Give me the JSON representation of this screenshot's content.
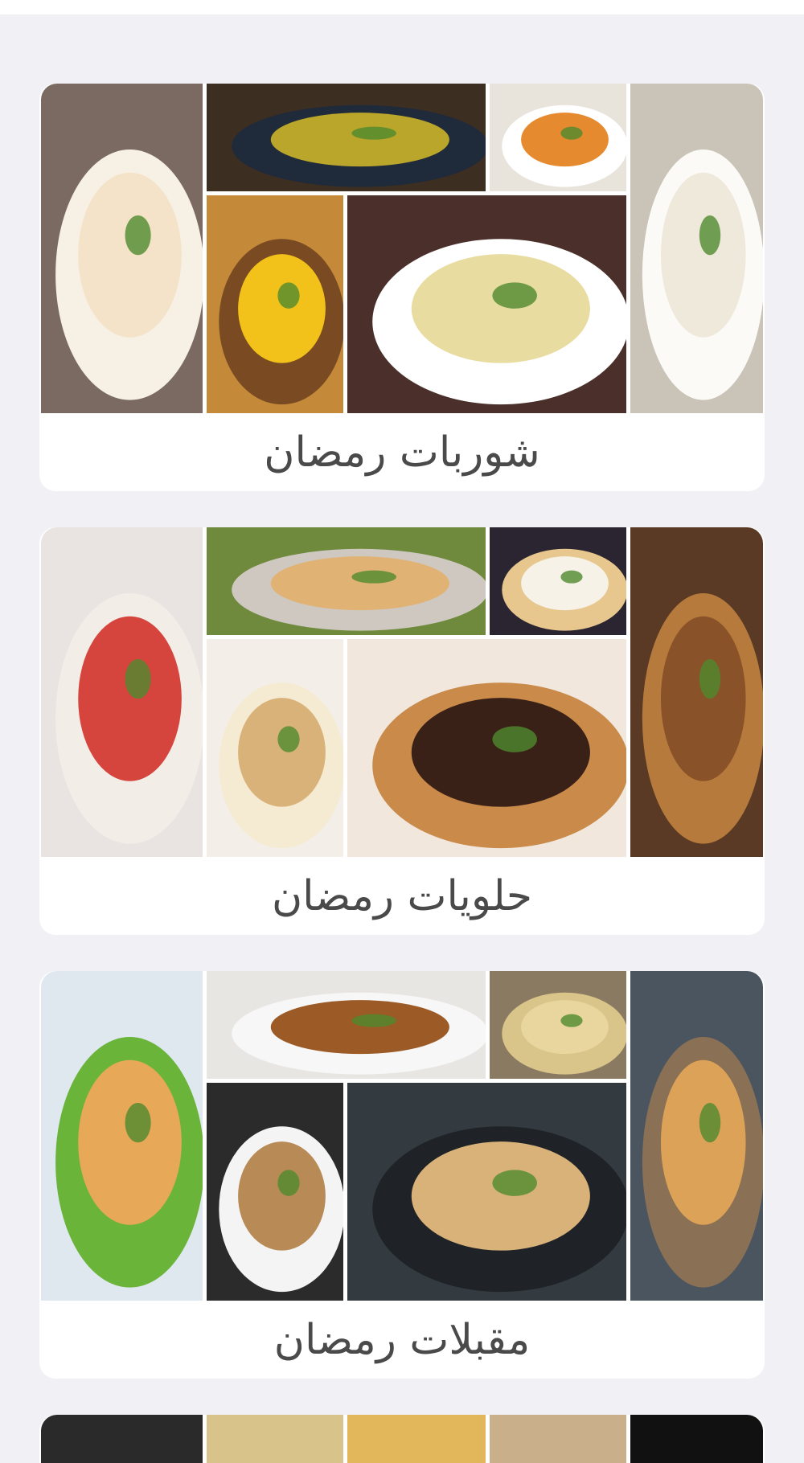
{
  "categories": [
    {
      "title": "شوربات رمضان",
      "colors": {
        "t1_bg": "#7a6a62",
        "t1_bowl": "#f7f0e4",
        "t1_food": "#f4e3c9",
        "t2_bg": "#3d2e22",
        "t2_bowl": "#1f2a3a",
        "t2_food": "#b9a62a",
        "t3_bg": "#e8e4dc",
        "t3_bowl": "#ffffff",
        "t3_food": "#e58a2f",
        "t4_bg": "#c48a3a",
        "t4_bowl": "#7a4a22",
        "t4_food": "#f2c21a",
        "t5_bg": "#4b2f2a",
        "t5_bowl": "#ffffff",
        "t5_food": "#e8dca0",
        "t6_bg": "#c9c3b8",
        "t6_bowl": "#fbfaf6",
        "t6_food": "#efe9db"
      }
    },
    {
      "title": "حلويات رمضان",
      "colors": {
        "t1_bg": "#e9e4e1",
        "t1_bowl": "#f2ede6",
        "t1_food": "#d6453d",
        "t2_bg": "#6f8a3d",
        "t2_bowl": "#cfc8c0",
        "t2_food": "#e0b274",
        "t3_bg": "#2a2530",
        "t3_bowl": "#e7c78e",
        "t3_food": "#f6f2e8",
        "t4_bg": "#f3efe8",
        "t4_bowl": "#f5ead2",
        "t4_food": "#d9b27a",
        "t5_bg": "#f1e7dc",
        "t5_bowl": "#c98a4a",
        "t5_food": "#3a2118",
        "t6_bg": "#5a3a24",
        "t6_bowl": "#b67a3c",
        "t6_food": "#8a5228"
      }
    },
    {
      "title": "مقبلات رمضان",
      "colors": {
        "t1_bg": "#dfe7ef",
        "t1_bowl": "#6ab43a",
        "t1_food": "#e7a858",
        "t2_bg": "#e8e6e2",
        "t2_bowl": "#f7f7f7",
        "t2_food": "#9b5a26",
        "t3_bg": "#8a7a62",
        "t3_bowl": "#d9c589",
        "t3_food": "#e9d59e",
        "t4_bg": "#2b2b2b",
        "t4_bowl": "#f4f4f4",
        "t4_food": "#b88a55",
        "t5_bg": "#333a40",
        "t5_bowl": "#1f2328",
        "t5_food": "#d9b279",
        "t6_bg": "#4a5560",
        "t6_bowl": "#8a7054",
        "t6_food": "#dca258"
      }
    }
  ],
  "peek_colors": [
    "#2a2a2a",
    "#d8c48a",
    "#e2b65a",
    "#c9b08a",
    "#111111"
  ]
}
